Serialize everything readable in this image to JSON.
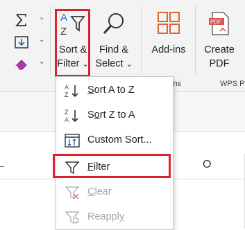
{
  "ribbon": {
    "sort_filter": {
      "line1": "Sort &",
      "line2": "Filter",
      "chevron": "⌄"
    },
    "find_select": {
      "line1": "Find &",
      "line2": "Select",
      "chevron": "⌄"
    },
    "add_ins": {
      "label": "Add-ins"
    },
    "create_pdf": {
      "line1": "Create",
      "line2": "PDF"
    },
    "group_labels": {
      "add_ins": "ins",
      "wps_pdf": "WPS P"
    },
    "small_chevron": "⌄"
  },
  "sheet": {
    "columns": [
      "O"
    ]
  },
  "sort_filter_menu": {
    "items": [
      {
        "label": "Sort A to Z",
        "accel": "S",
        "icon": "sort-ascending-icon",
        "enabled": true
      },
      {
        "label": "Sort Z to A",
        "accel": "o",
        "icon": "sort-descending-icon",
        "enabled": true
      },
      {
        "label": "Custom Sort...",
        "accel": "U",
        "icon": "custom-sort-icon",
        "enabled": true
      },
      {
        "label": "Filter",
        "accel": "F",
        "icon": "filter-icon",
        "enabled": true
      },
      {
        "label": "Clear",
        "accel": "C",
        "icon": "clear-filter-icon",
        "enabled": false
      },
      {
        "label": "Reapply",
        "accel": "y",
        "icon": "reapply-filter-icon",
        "enabled": false
      }
    ]
  },
  "colors": {
    "highlight": "#d8242a",
    "ribbon_bg": "#f3f3f3",
    "sort_blue": "#2b6cb3",
    "pdf_red": "#d9534f",
    "addin_orange": "#d9672f"
  },
  "pdf_badge": "PDF"
}
